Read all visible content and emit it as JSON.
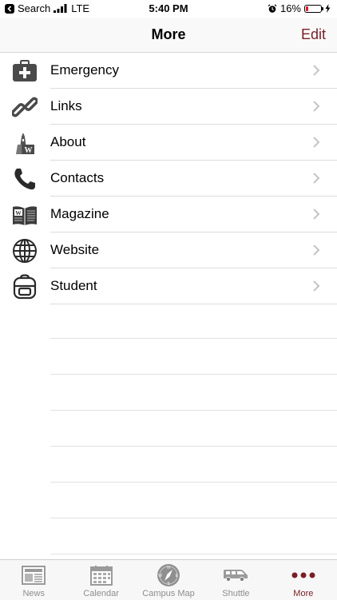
{
  "colors": {
    "accent": "#7a1e25",
    "battery_low": "#e0181e",
    "tab_inactive": "#8e8e8e"
  },
  "status_bar": {
    "back_app": "Search",
    "network": "LTE",
    "time": "5:40 PM",
    "battery_percent": "16%",
    "battery_level": 0.16
  },
  "nav": {
    "title": "More",
    "edit_label": "Edit"
  },
  "menu": {
    "items": [
      {
        "label": "Emergency",
        "icon": "first-aid-kit-icon"
      },
      {
        "label": "Links",
        "icon": "chain-link-icon"
      },
      {
        "label": "About",
        "icon": "college-seal-icon"
      },
      {
        "label": "Contacts",
        "icon": "phone-icon"
      },
      {
        "label": "Magazine",
        "icon": "magazine-icon"
      },
      {
        "label": "Website",
        "icon": "globe-icon"
      },
      {
        "label": "Student",
        "icon": "backpack-icon"
      }
    ]
  },
  "tabs": [
    {
      "label": "News",
      "icon": "newspaper-icon",
      "active": false
    },
    {
      "label": "Calendar",
      "icon": "calendar-icon",
      "active": false
    },
    {
      "label": "Campus Map",
      "icon": "compass-icon",
      "active": false
    },
    {
      "label": "Shuttle",
      "icon": "van-icon",
      "active": false
    },
    {
      "label": "More",
      "icon": "more-dots-icon",
      "active": true
    }
  ]
}
